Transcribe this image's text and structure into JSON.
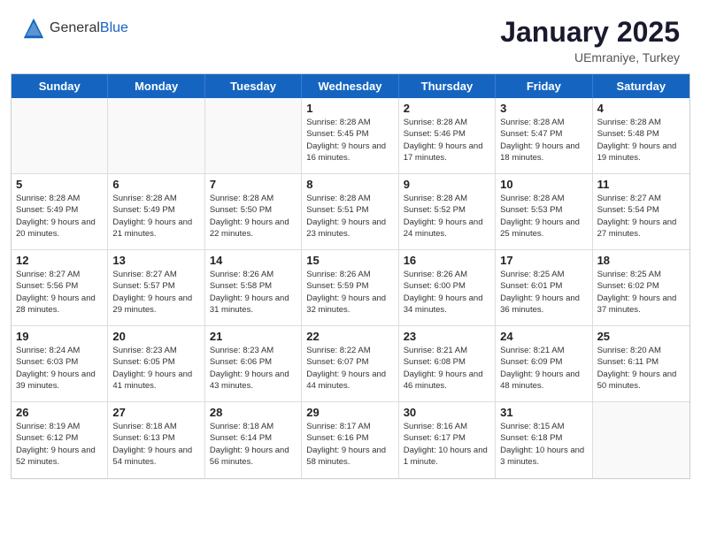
{
  "header": {
    "logo_general": "General",
    "logo_blue": "Blue",
    "title": "January 2025",
    "location": "UEmraniye, Turkey"
  },
  "weekdays": [
    "Sunday",
    "Monday",
    "Tuesday",
    "Wednesday",
    "Thursday",
    "Friday",
    "Saturday"
  ],
  "weeks": [
    [
      {
        "day": "",
        "empty": true
      },
      {
        "day": "",
        "empty": true
      },
      {
        "day": "",
        "empty": true
      },
      {
        "day": "1",
        "sunrise": "8:28 AM",
        "sunset": "5:45 PM",
        "daylight": "9 hours and 16 minutes."
      },
      {
        "day": "2",
        "sunrise": "8:28 AM",
        "sunset": "5:46 PM",
        "daylight": "9 hours and 17 minutes."
      },
      {
        "day": "3",
        "sunrise": "8:28 AM",
        "sunset": "5:47 PM",
        "daylight": "9 hours and 18 minutes."
      },
      {
        "day": "4",
        "sunrise": "8:28 AM",
        "sunset": "5:48 PM",
        "daylight": "9 hours and 19 minutes."
      }
    ],
    [
      {
        "day": "5",
        "sunrise": "8:28 AM",
        "sunset": "5:49 PM",
        "daylight": "9 hours and 20 minutes."
      },
      {
        "day": "6",
        "sunrise": "8:28 AM",
        "sunset": "5:49 PM",
        "daylight": "9 hours and 21 minutes."
      },
      {
        "day": "7",
        "sunrise": "8:28 AM",
        "sunset": "5:50 PM",
        "daylight": "9 hours and 22 minutes."
      },
      {
        "day": "8",
        "sunrise": "8:28 AM",
        "sunset": "5:51 PM",
        "daylight": "9 hours and 23 minutes."
      },
      {
        "day": "9",
        "sunrise": "8:28 AM",
        "sunset": "5:52 PM",
        "daylight": "9 hours and 24 minutes."
      },
      {
        "day": "10",
        "sunrise": "8:28 AM",
        "sunset": "5:53 PM",
        "daylight": "9 hours and 25 minutes."
      },
      {
        "day": "11",
        "sunrise": "8:27 AM",
        "sunset": "5:54 PM",
        "daylight": "9 hours and 27 minutes."
      }
    ],
    [
      {
        "day": "12",
        "sunrise": "8:27 AM",
        "sunset": "5:56 PM",
        "daylight": "9 hours and 28 minutes."
      },
      {
        "day": "13",
        "sunrise": "8:27 AM",
        "sunset": "5:57 PM",
        "daylight": "9 hours and 29 minutes."
      },
      {
        "day": "14",
        "sunrise": "8:26 AM",
        "sunset": "5:58 PM",
        "daylight": "9 hours and 31 minutes."
      },
      {
        "day": "15",
        "sunrise": "8:26 AM",
        "sunset": "5:59 PM",
        "daylight": "9 hours and 32 minutes."
      },
      {
        "day": "16",
        "sunrise": "8:26 AM",
        "sunset": "6:00 PM",
        "daylight": "9 hours and 34 minutes."
      },
      {
        "day": "17",
        "sunrise": "8:25 AM",
        "sunset": "6:01 PM",
        "daylight": "9 hours and 36 minutes."
      },
      {
        "day": "18",
        "sunrise": "8:25 AM",
        "sunset": "6:02 PM",
        "daylight": "9 hours and 37 minutes."
      }
    ],
    [
      {
        "day": "19",
        "sunrise": "8:24 AM",
        "sunset": "6:03 PM",
        "daylight": "9 hours and 39 minutes."
      },
      {
        "day": "20",
        "sunrise": "8:23 AM",
        "sunset": "6:05 PM",
        "daylight": "9 hours and 41 minutes."
      },
      {
        "day": "21",
        "sunrise": "8:23 AM",
        "sunset": "6:06 PM",
        "daylight": "9 hours and 43 minutes."
      },
      {
        "day": "22",
        "sunrise": "8:22 AM",
        "sunset": "6:07 PM",
        "daylight": "9 hours and 44 minutes."
      },
      {
        "day": "23",
        "sunrise": "8:21 AM",
        "sunset": "6:08 PM",
        "daylight": "9 hours and 46 minutes."
      },
      {
        "day": "24",
        "sunrise": "8:21 AM",
        "sunset": "6:09 PM",
        "daylight": "9 hours and 48 minutes."
      },
      {
        "day": "25",
        "sunrise": "8:20 AM",
        "sunset": "6:11 PM",
        "daylight": "9 hours and 50 minutes."
      }
    ],
    [
      {
        "day": "26",
        "sunrise": "8:19 AM",
        "sunset": "6:12 PM",
        "daylight": "9 hours and 52 minutes."
      },
      {
        "day": "27",
        "sunrise": "8:18 AM",
        "sunset": "6:13 PM",
        "daylight": "9 hours and 54 minutes."
      },
      {
        "day": "28",
        "sunrise": "8:18 AM",
        "sunset": "6:14 PM",
        "daylight": "9 hours and 56 minutes."
      },
      {
        "day": "29",
        "sunrise": "8:17 AM",
        "sunset": "6:16 PM",
        "daylight": "9 hours and 58 minutes."
      },
      {
        "day": "30",
        "sunrise": "8:16 AM",
        "sunset": "6:17 PM",
        "daylight": "10 hours and 1 minute."
      },
      {
        "day": "31",
        "sunrise": "8:15 AM",
        "sunset": "6:18 PM",
        "daylight": "10 hours and 3 minutes."
      },
      {
        "day": "",
        "empty": true
      }
    ]
  ]
}
